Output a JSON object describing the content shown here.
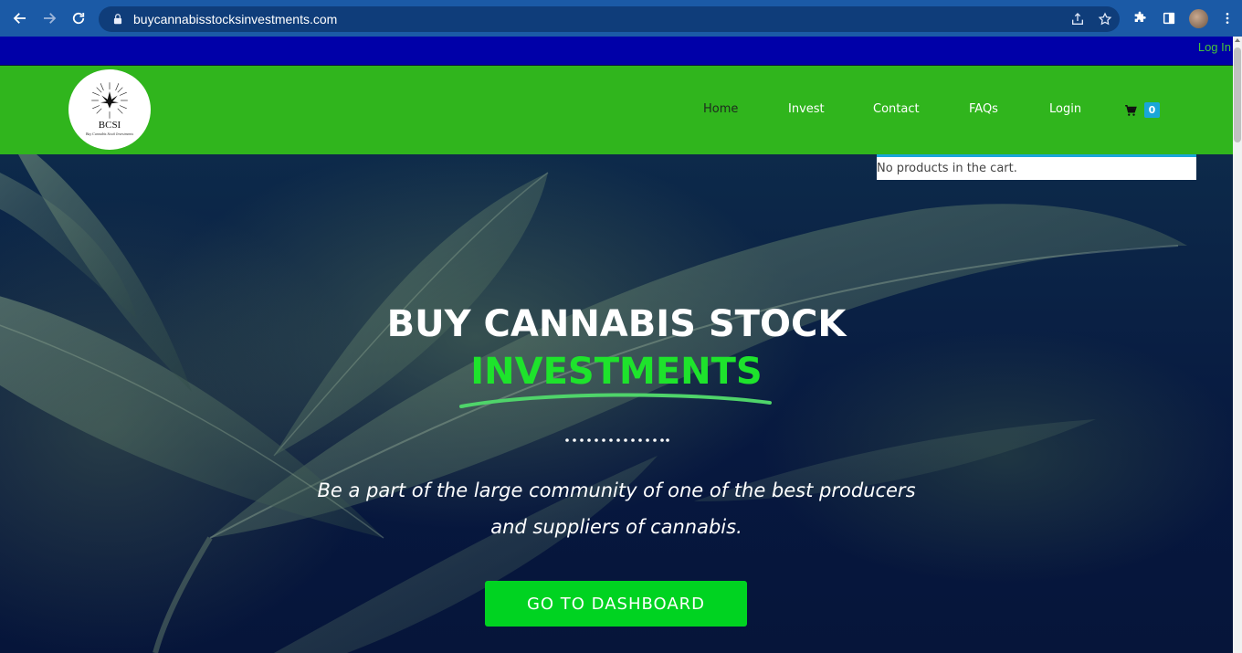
{
  "browser": {
    "url": "buycannabisstocksinvestments.com"
  },
  "topbar": {
    "login_label": "Log In"
  },
  "logo": {
    "mark": "BCSI",
    "tagline": "Buy Cannabis Stock Investments"
  },
  "nav": {
    "items": [
      {
        "label": "Home",
        "active": true
      },
      {
        "label": "Invest"
      },
      {
        "label": "Contact"
      },
      {
        "label": "FAQs"
      },
      {
        "label": "Login"
      }
    ],
    "cart_count": "0",
    "cart_empty_text": "No products in the cart."
  },
  "hero": {
    "title_line1": "BUY CANNABIS STOCK",
    "title_line2": "INVESTMENTS",
    "subtitle_line1": "Be a part of the large community of one of the best producers",
    "subtitle_line2": "and suppliers of cannabis.",
    "cta_label": "GO TO DASHBOARD"
  },
  "colors": {
    "topbar": "#0000a8",
    "header": "#30b51d",
    "accent_green": "#1ee32c",
    "cta": "#00d321",
    "cart_badge": "#19a6d9"
  },
  "icons": [
    "back-icon",
    "forward-icon",
    "reload-icon",
    "lock-icon",
    "share-icon",
    "star-icon",
    "extensions-icon",
    "side-panel-icon",
    "menu-icon",
    "cart-icon"
  ]
}
